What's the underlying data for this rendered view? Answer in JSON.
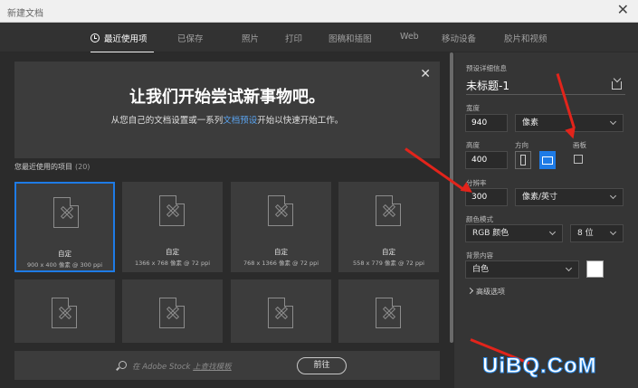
{
  "window": {
    "title": "新建文档"
  },
  "tabs": [
    {
      "label": "最近使用项"
    },
    {
      "label": "已保存"
    },
    {
      "label": "照片"
    },
    {
      "label": "打印"
    },
    {
      "label": "图稿和插图"
    },
    {
      "label": "Web"
    },
    {
      "label": "移动设备"
    },
    {
      "label": "胶片和视频"
    }
  ],
  "banner": {
    "heading": "让我们开始尝试新事物吧。",
    "sub_prefix": "从您自己的文档设置或一系列",
    "sub_link": "文档预设",
    "sub_suffix": "开始以快速开始工作。"
  },
  "recent": {
    "title": "您最近使用的项目",
    "count": "(20)",
    "items": [
      {
        "name": "自定",
        "size": "900 x 400 像素 @ 300 ppi"
      },
      {
        "name": "自定",
        "size": "1366 x 768 像素 @ 72 ppi"
      },
      {
        "name": "自定",
        "size": "768 x 1366 像素 @ 72 ppi"
      },
      {
        "name": "自定",
        "size": "558 x 779 像素 @ 72 ppi"
      }
    ]
  },
  "search": {
    "placeholder_prefix": "在 Adobe Stock ",
    "placeholder_link": "上查找模板",
    "go_label": "前往"
  },
  "preset": {
    "section_title": "预设详细信息",
    "doc_name": "未标题-1",
    "width_label": "宽度",
    "width_value": "940",
    "width_unit": "像素",
    "height_label": "高度",
    "height_value": "400",
    "orientation_label": "方向",
    "artboard_label": "画板",
    "resolution_label": "分辨率",
    "resolution_value": "300",
    "resolution_unit": "像素/英寸",
    "color_mode_label": "颜色模式",
    "color_mode_value": "RGB 颜色",
    "bit_depth_value": "8 位",
    "background_label": "背景内容",
    "background_value": "白色",
    "advanced_label": "高级选项"
  },
  "watermark": {
    "text": "UiBQ.CoM"
  },
  "colors": {
    "accent": "#1e7be6",
    "annotation": "#e2241b",
    "link": "#5aa3ef"
  }
}
